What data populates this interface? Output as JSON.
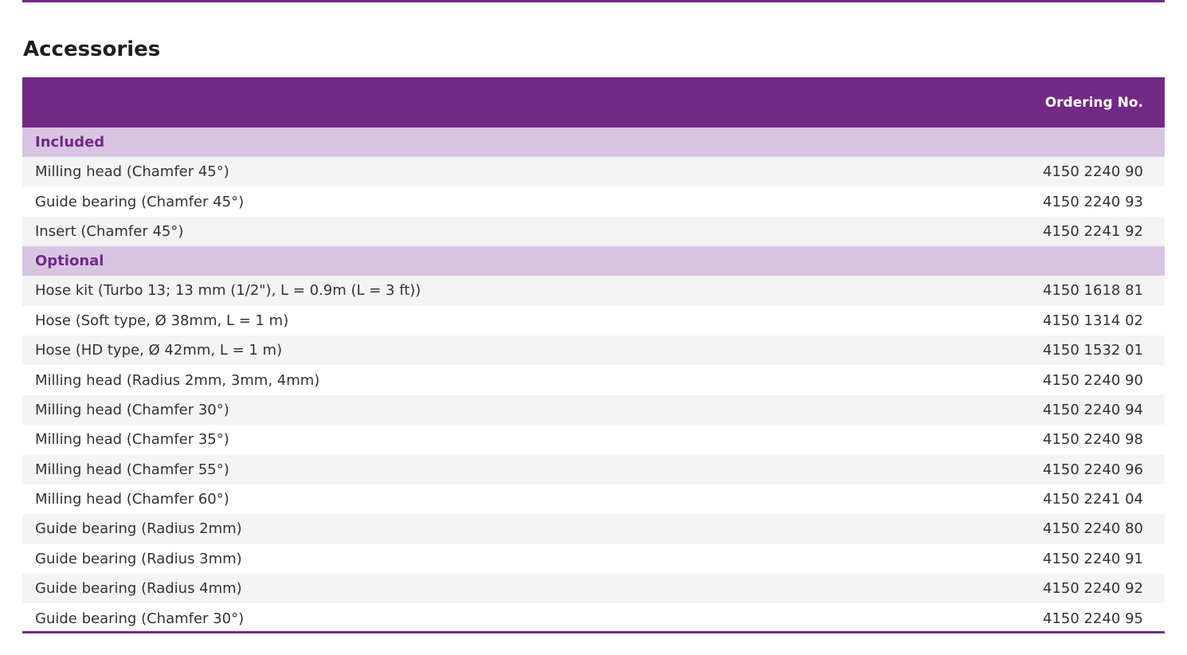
{
  "title": "Accessories",
  "table": {
    "header": {
      "description": "",
      "ordering_no": "Ordering No."
    },
    "groups": [
      {
        "label": "Included",
        "items": [
          {
            "description": "Milling head (Chamfer 45°)",
            "ordering_no": "4150 2240 90"
          },
          {
            "description": "Guide bearing (Chamfer 45°)",
            "ordering_no": "4150 2240 93"
          },
          {
            "description": "Insert (Chamfer 45°)",
            "ordering_no": "4150 2241 92"
          }
        ]
      },
      {
        "label": "Optional",
        "items": [
          {
            "description": "Hose kit (Turbo 13; 13 mm (1/2\"), L = 0.9m (L = 3 ft))",
            "ordering_no": "4150 1618 81"
          },
          {
            "description": "Hose (Soft type, Ø 38mm, L = 1 m)",
            "ordering_no": "4150 1314 02"
          },
          {
            "description": "Hose (HD type, Ø 42mm, L = 1 m)",
            "ordering_no": "4150 1532 01"
          },
          {
            "description": "Milling head (Radius 2mm, 3mm, 4mm)",
            "ordering_no": "4150 2240 90"
          },
          {
            "description": "Milling head (Chamfer 30°)",
            "ordering_no": "4150 2240 94"
          },
          {
            "description": "Milling head (Chamfer 35°)",
            "ordering_no": "4150 2240 98"
          },
          {
            "description": "Milling head (Chamfer 55°)",
            "ordering_no": "4150 2240 96"
          },
          {
            "description": "Milling head (Chamfer 60°)",
            "ordering_no": "4150 2241 04"
          },
          {
            "description": "Guide bearing (Radius 2mm)",
            "ordering_no": "4150 2240 80"
          },
          {
            "description": "Guide bearing (Radius 3mm)",
            "ordering_no": "4150 2240 91"
          },
          {
            "description": "Guide bearing (Radius 4mm)",
            "ordering_no": "4150 2240 92"
          },
          {
            "description": "Guide bearing (Chamfer 30°)",
            "ordering_no": "4150 2240 95"
          }
        ]
      }
    ]
  },
  "colors": {
    "accent": "#722a85",
    "group_bg": "#d8c5e2",
    "row_shade": "#f4f4f4"
  }
}
